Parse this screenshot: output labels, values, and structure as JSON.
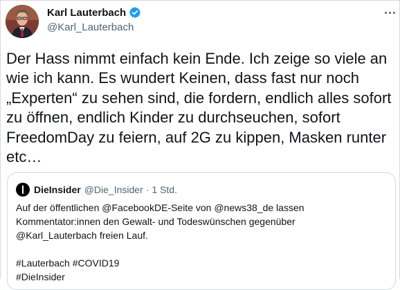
{
  "author": {
    "name": "Karl Lauterbach",
    "handle": "@Karl_Lauterbach"
  },
  "tweet": {
    "text": "Der Hass nimmt einfach kein Ende. Ich zeige so viele an wie ich kann. Es wundert Keinen, dass fast nur noch „Experten“ zu sehen sind, die fordern, endlich alles sofort zu öffnen, endlich Kinder zu durchseuchen, sofort FreedomDay zu feiern, auf 2G zu kippen, Masken runter etc…"
  },
  "quoted": {
    "name": "DieInsider",
    "handle": "@Die_Insider",
    "separator": "·",
    "time": "1 Std.",
    "text": "Auf der öffentlichen @FacebookDE-Seite von @news38_de lassen\nKommentator:innen den Gewalt- und Todeswünschen gegenüber\n@Karl_Lauterbach freien Lauf.\n\n#Lauterbach #COVID19\n#DieInsider"
  },
  "colors": {
    "verified": "#1d9bf0",
    "secondary_text": "#536471",
    "border": "#cfd9de"
  },
  "icons": {
    "verified": "verified-badge-icon",
    "more": "more-options-icon"
  }
}
